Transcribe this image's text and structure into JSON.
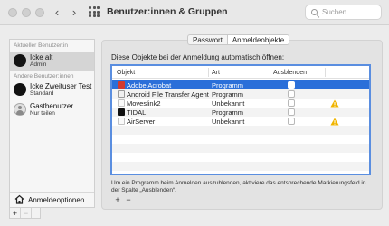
{
  "window": {
    "title": "Benutzer:innen & Gruppen",
    "search_placeholder": "Suchen"
  },
  "sidebar": {
    "current_section": "Aktueller Benutzer:in",
    "other_section": "Andere Benutzer:innen",
    "users": [
      {
        "name": "Icke alt",
        "role": "Admin",
        "selected": true
      },
      {
        "name": "Icke Zweituser Test",
        "role": "Standard",
        "selected": false
      },
      {
        "name": "Gastbenutzer",
        "role": "Nur teilen",
        "selected": false
      }
    ],
    "login_options_label": "Anmeldeoptionen",
    "add_label": "+",
    "remove_label": "−"
  },
  "tabs": [
    {
      "label": "Passwort",
      "selected": false
    },
    {
      "label": "Anmeldeobjekte",
      "selected": true
    }
  ],
  "login_items": {
    "instruction": "Diese Objekte bei der Anmeldung automatisch öffnen:",
    "columns": [
      "Objekt",
      "Art",
      "Ausblenden"
    ],
    "rows": [
      {
        "name": "Adobe Acrobat",
        "art": "Programm",
        "hide": false,
        "warning": false,
        "selected": true,
        "icon": "acrobat-icon"
      },
      {
        "name": "Android File Transfer Agent",
        "art": "Programm",
        "hide": false,
        "warning": false,
        "selected": false,
        "icon": "android-file-transfer-icon"
      },
      {
        "name": "Moveslink2",
        "art": "Unbekannt",
        "hide": false,
        "warning": true,
        "selected": false,
        "icon": "generic-app-icon"
      },
      {
        "name": "TIDAL",
        "art": "Programm",
        "hide": false,
        "warning": false,
        "selected": false,
        "icon": "tidal-icon"
      },
      {
        "name": "AirServer",
        "art": "Unbekannt",
        "hide": false,
        "warning": true,
        "selected": false,
        "icon": "generic-app-icon"
      }
    ],
    "note": "Um ein Programm beim Anmelden auszublenden, aktiviere das entsprechende Markierungsfeld in der Spalte „Ausblenden“.",
    "add_label": "+",
    "remove_label": "−"
  },
  "colors": {
    "selection": "#2b6fd9",
    "focus_ring": "#5a8ee0",
    "warning": "#f0b400"
  }
}
